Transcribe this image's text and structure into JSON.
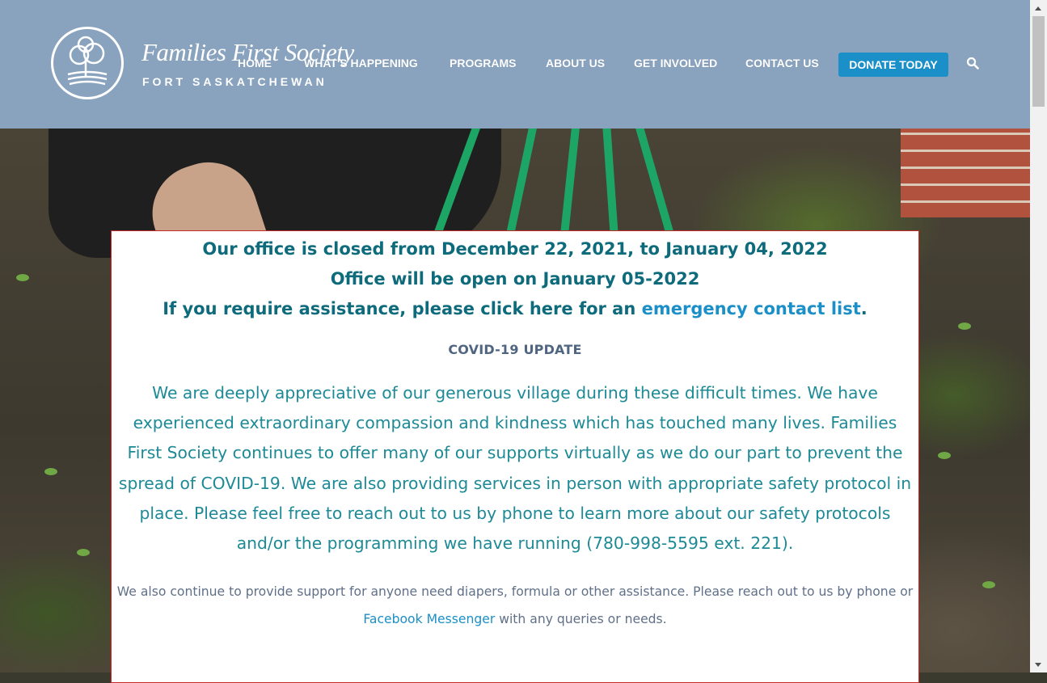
{
  "brand": {
    "title": "Families First Society",
    "subtitle": "FORT SASKATCHEWAN"
  },
  "nav": {
    "items": [
      {
        "label": "HOME"
      },
      {
        "label": "WHAT'S HAPPENING"
      },
      {
        "label": "PROGRAMS"
      },
      {
        "label": "ABOUT US"
      },
      {
        "label": "GET INVOLVED"
      },
      {
        "label": "CONTACT US"
      }
    ],
    "donate_label": "DONATE TODAY",
    "search_icon": "search-icon"
  },
  "colors": {
    "header_bg": "#89a3bf",
    "donate_bg": "#1b8fc7",
    "notice_heading": "#0e6b7c",
    "notice_link": "#1b8fc7",
    "notice_body": "#1d8a96",
    "notice_border": "#c42a2a"
  },
  "notice": {
    "line1": "Our office is closed from December 22, 2021, to January 04, 2022",
    "line2": "Office will be open on January 05-2022",
    "line3_prefix": "If you require assistance, please click here for an ",
    "line3_link": "emergency contact list",
    "line3_suffix": ".",
    "covid_title": "COVID-19 UPDATE",
    "covid_body": "We are deeply appreciative of our generous village during these difficult times. We have experienced extraordinary compassion and kindness which has touched many lives. Families First Society continues to offer many of our supports virtually as we do our part to prevent the spread of COVID-19. We are also providing services in person with appropriate safety protocol in place. Please feel free to reach out to us by phone to learn more about our safety protocols and/or the programming we have running (780-998-5595 ext. 221).",
    "support_prefix": "We also continue to provide support for anyone need diapers, formula or other assistance. Please reach out to us by phone or ",
    "support_link": "Facebook Messenger",
    "support_suffix": " with any queries or needs."
  }
}
